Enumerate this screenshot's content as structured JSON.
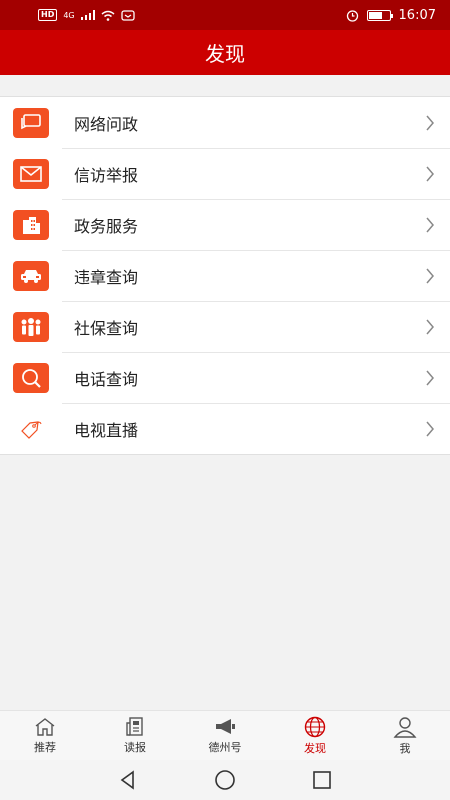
{
  "status_bar": {
    "network": "4G",
    "time": "16:07"
  },
  "header": {
    "title": "发现"
  },
  "menu": [
    {
      "label": "网络问政",
      "icon": "chat-bubble-icon"
    },
    {
      "label": "信访举报",
      "icon": "envelope-icon"
    },
    {
      "label": "政务服务",
      "icon": "building-icon"
    },
    {
      "label": "违章查询",
      "icon": "car-icon"
    },
    {
      "label": "社保查询",
      "icon": "people-icon"
    },
    {
      "label": "电话查询",
      "icon": "magnifier-icon"
    },
    {
      "label": "电视直播",
      "icon": "tag-icon"
    }
  ],
  "bottom_nav": [
    {
      "label": "推荐",
      "icon": "home-icon"
    },
    {
      "label": "读报",
      "icon": "newspaper-icon"
    },
    {
      "label": "德州号",
      "icon": "megaphone-icon"
    },
    {
      "label": "发现",
      "icon": "globe-icon",
      "active": true
    },
    {
      "label": "我",
      "icon": "user-icon"
    }
  ],
  "colors": {
    "status_bar": "#a30000",
    "header": "#cc0000",
    "icon_bg": "#f25022",
    "active": "#cc0000"
  }
}
